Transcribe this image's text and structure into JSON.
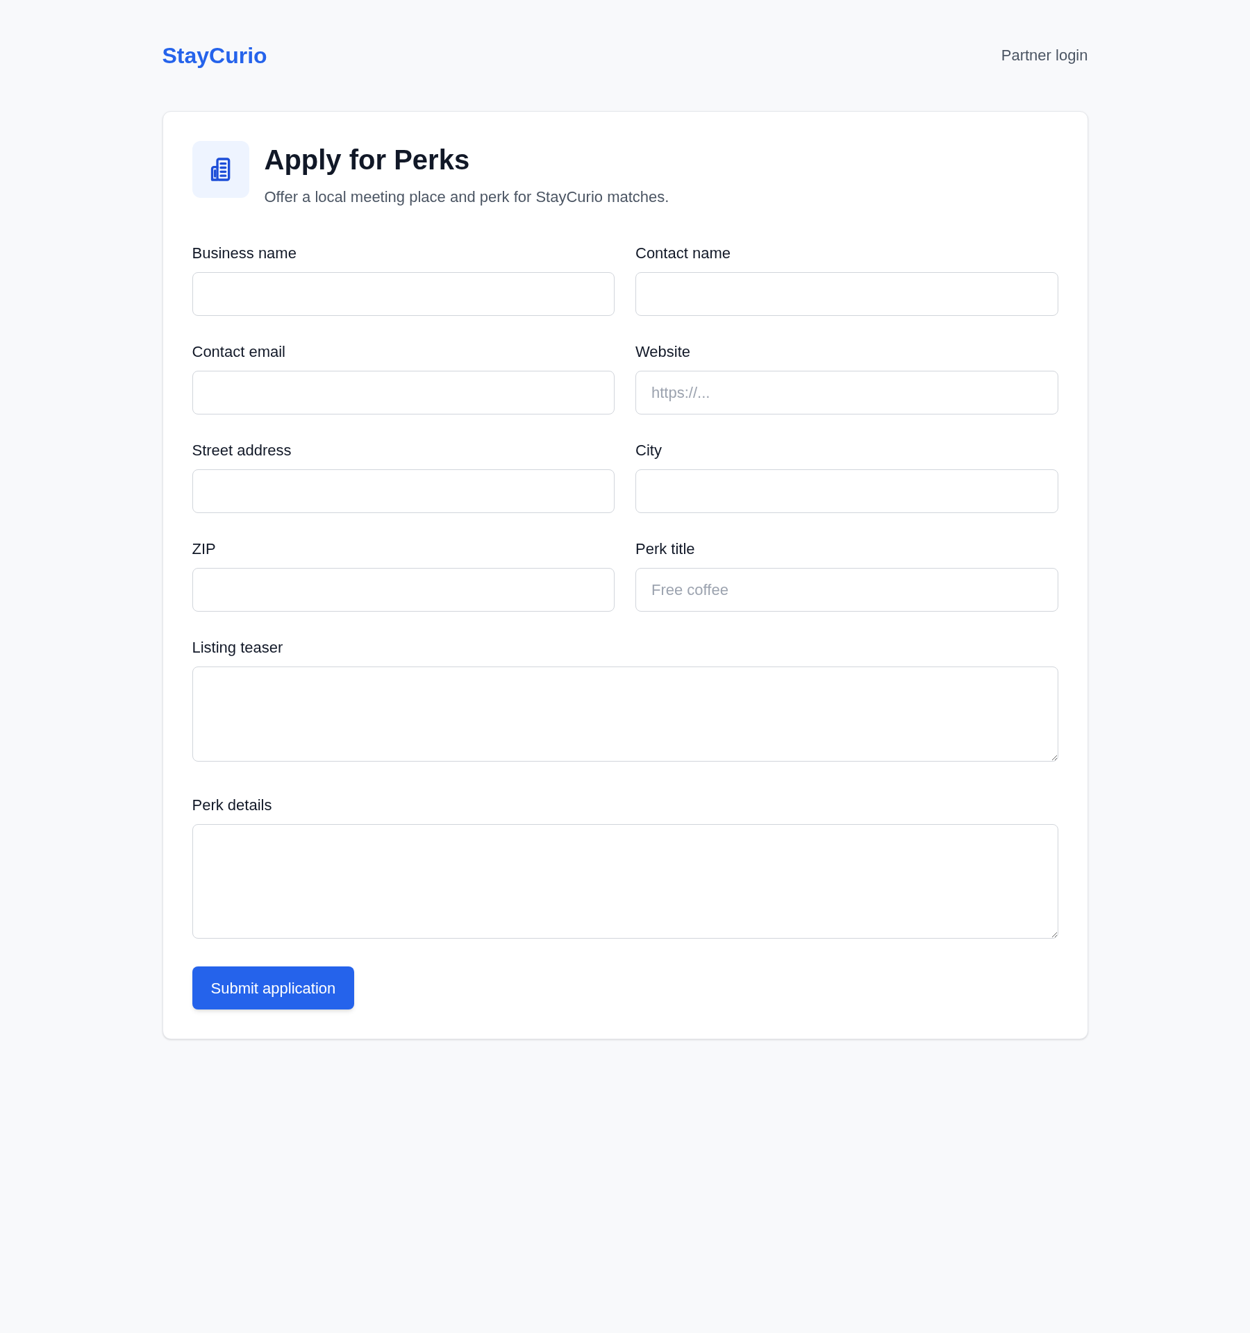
{
  "header": {
    "logo": "StayCurio",
    "partner_login": "Partner login"
  },
  "card": {
    "title": "Apply for Perks",
    "subtitle": "Offer a local meeting place and perk for StayCurio matches.",
    "fields": [
      {
        "label": "Business name",
        "kind": "input"
      },
      {
        "label": "Contact name",
        "kind": "input"
      },
      {
        "label": "Contact email",
        "kind": "input"
      },
      {
        "label": "Website",
        "kind": "input",
        "placeholder": "https://..."
      },
      {
        "label": "Street address",
        "kind": "input"
      },
      {
        "label": "City",
        "kind": "input"
      },
      {
        "label": "ZIP",
        "kind": "input"
      },
      {
        "label": "Perk title",
        "kind": "input",
        "placeholder": "Free coffee"
      },
      {
        "label": "Listing teaser",
        "kind": "textarea"
      },
      {
        "label": "Perk details",
        "kind": "textarea"
      }
    ],
    "submit_button": "Submit application"
  }
}
